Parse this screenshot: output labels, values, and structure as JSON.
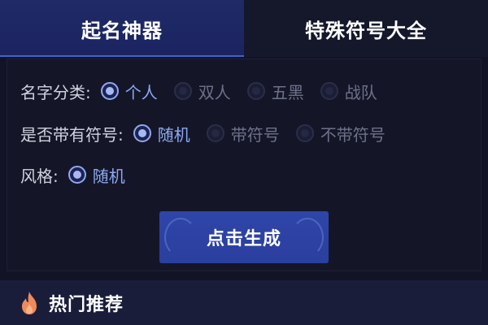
{
  "tabs": [
    {
      "label": "起名神器",
      "active": true
    },
    {
      "label": "特殊符号大全",
      "active": false
    }
  ],
  "options": {
    "category": {
      "label": "名字分类:",
      "choices": [
        {
          "label": "个人",
          "selected": true
        },
        {
          "label": "双人",
          "selected": false
        },
        {
          "label": "五黑",
          "selected": false
        },
        {
          "label": "战队",
          "selected": false
        }
      ]
    },
    "symbol": {
      "label": "是否带有符号:",
      "choices": [
        {
          "label": "随机",
          "selected": true
        },
        {
          "label": "带符号",
          "selected": false
        },
        {
          "label": "不带符号",
          "selected": false
        }
      ]
    },
    "style": {
      "label": "风格:",
      "choices": [
        {
          "label": "随机",
          "selected": true
        }
      ]
    }
  },
  "generate_button": {
    "label": "点击生成"
  },
  "hot_section": {
    "title": "热门推荐",
    "icon": "flame-icon"
  },
  "colors": {
    "accent": "#8ea9f2",
    "button": "#2f45a8",
    "flame": "#f08a5a"
  }
}
